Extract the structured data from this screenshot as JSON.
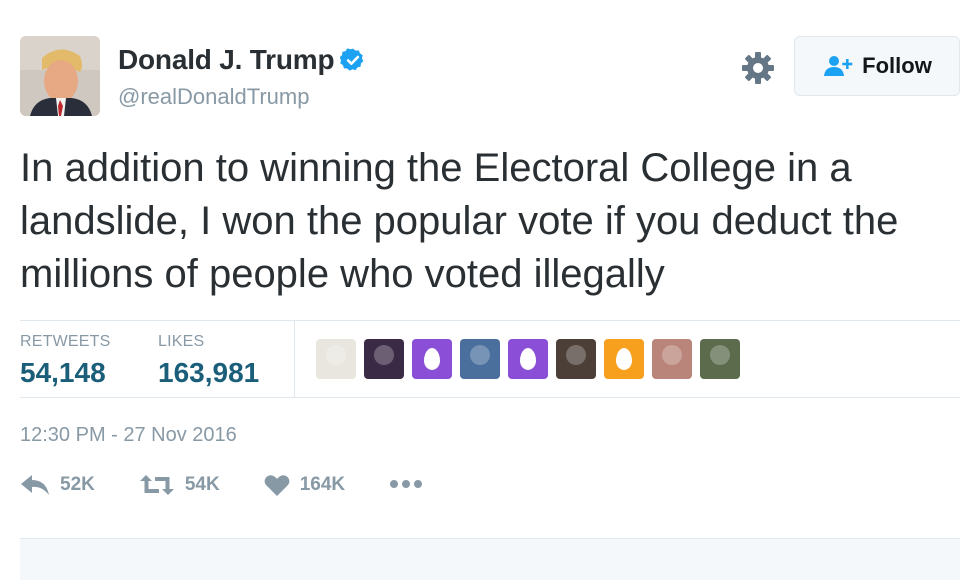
{
  "user": {
    "display_name": "Donald J. Trump",
    "handle": "@realDonaldTrump",
    "verified": true,
    "avatar_icon": "profile-photo"
  },
  "header": {
    "settings_icon": "gear-icon",
    "follow_label": "Follow",
    "follow_icon": "add-user-icon"
  },
  "tweet": {
    "text": "In addition to winning the Electoral College in a landslide, I won the popular vote if you deduct the millions of people who voted illegally",
    "timestamp": "12:30 PM - 27 Nov 2016"
  },
  "stats": {
    "retweets_label": "RETWEETS",
    "retweets_count": "54,148",
    "likes_label": "LIKES",
    "likes_count": "163,981"
  },
  "likers": [
    {
      "kind": "photo",
      "color": "#e9e6df"
    },
    {
      "kind": "photo",
      "color": "#3b2a46"
    },
    {
      "kind": "egg",
      "color": "#8a4fd6"
    },
    {
      "kind": "photo",
      "color": "#4a6f9c"
    },
    {
      "kind": "egg",
      "color": "#8a4fd6"
    },
    {
      "kind": "photo",
      "color": "#4b3f38"
    },
    {
      "kind": "egg",
      "color": "#f7a01e"
    },
    {
      "kind": "photo",
      "color": "#b9857a"
    },
    {
      "kind": "photo",
      "color": "#5b6b4c"
    }
  ],
  "actions": {
    "reply_count": "52K",
    "retweet_count": "54K",
    "like_count": "164K"
  },
  "colors": {
    "accent": "#1da1f2",
    "count_color": "#1b5e7a",
    "muted": "#8899a6"
  }
}
